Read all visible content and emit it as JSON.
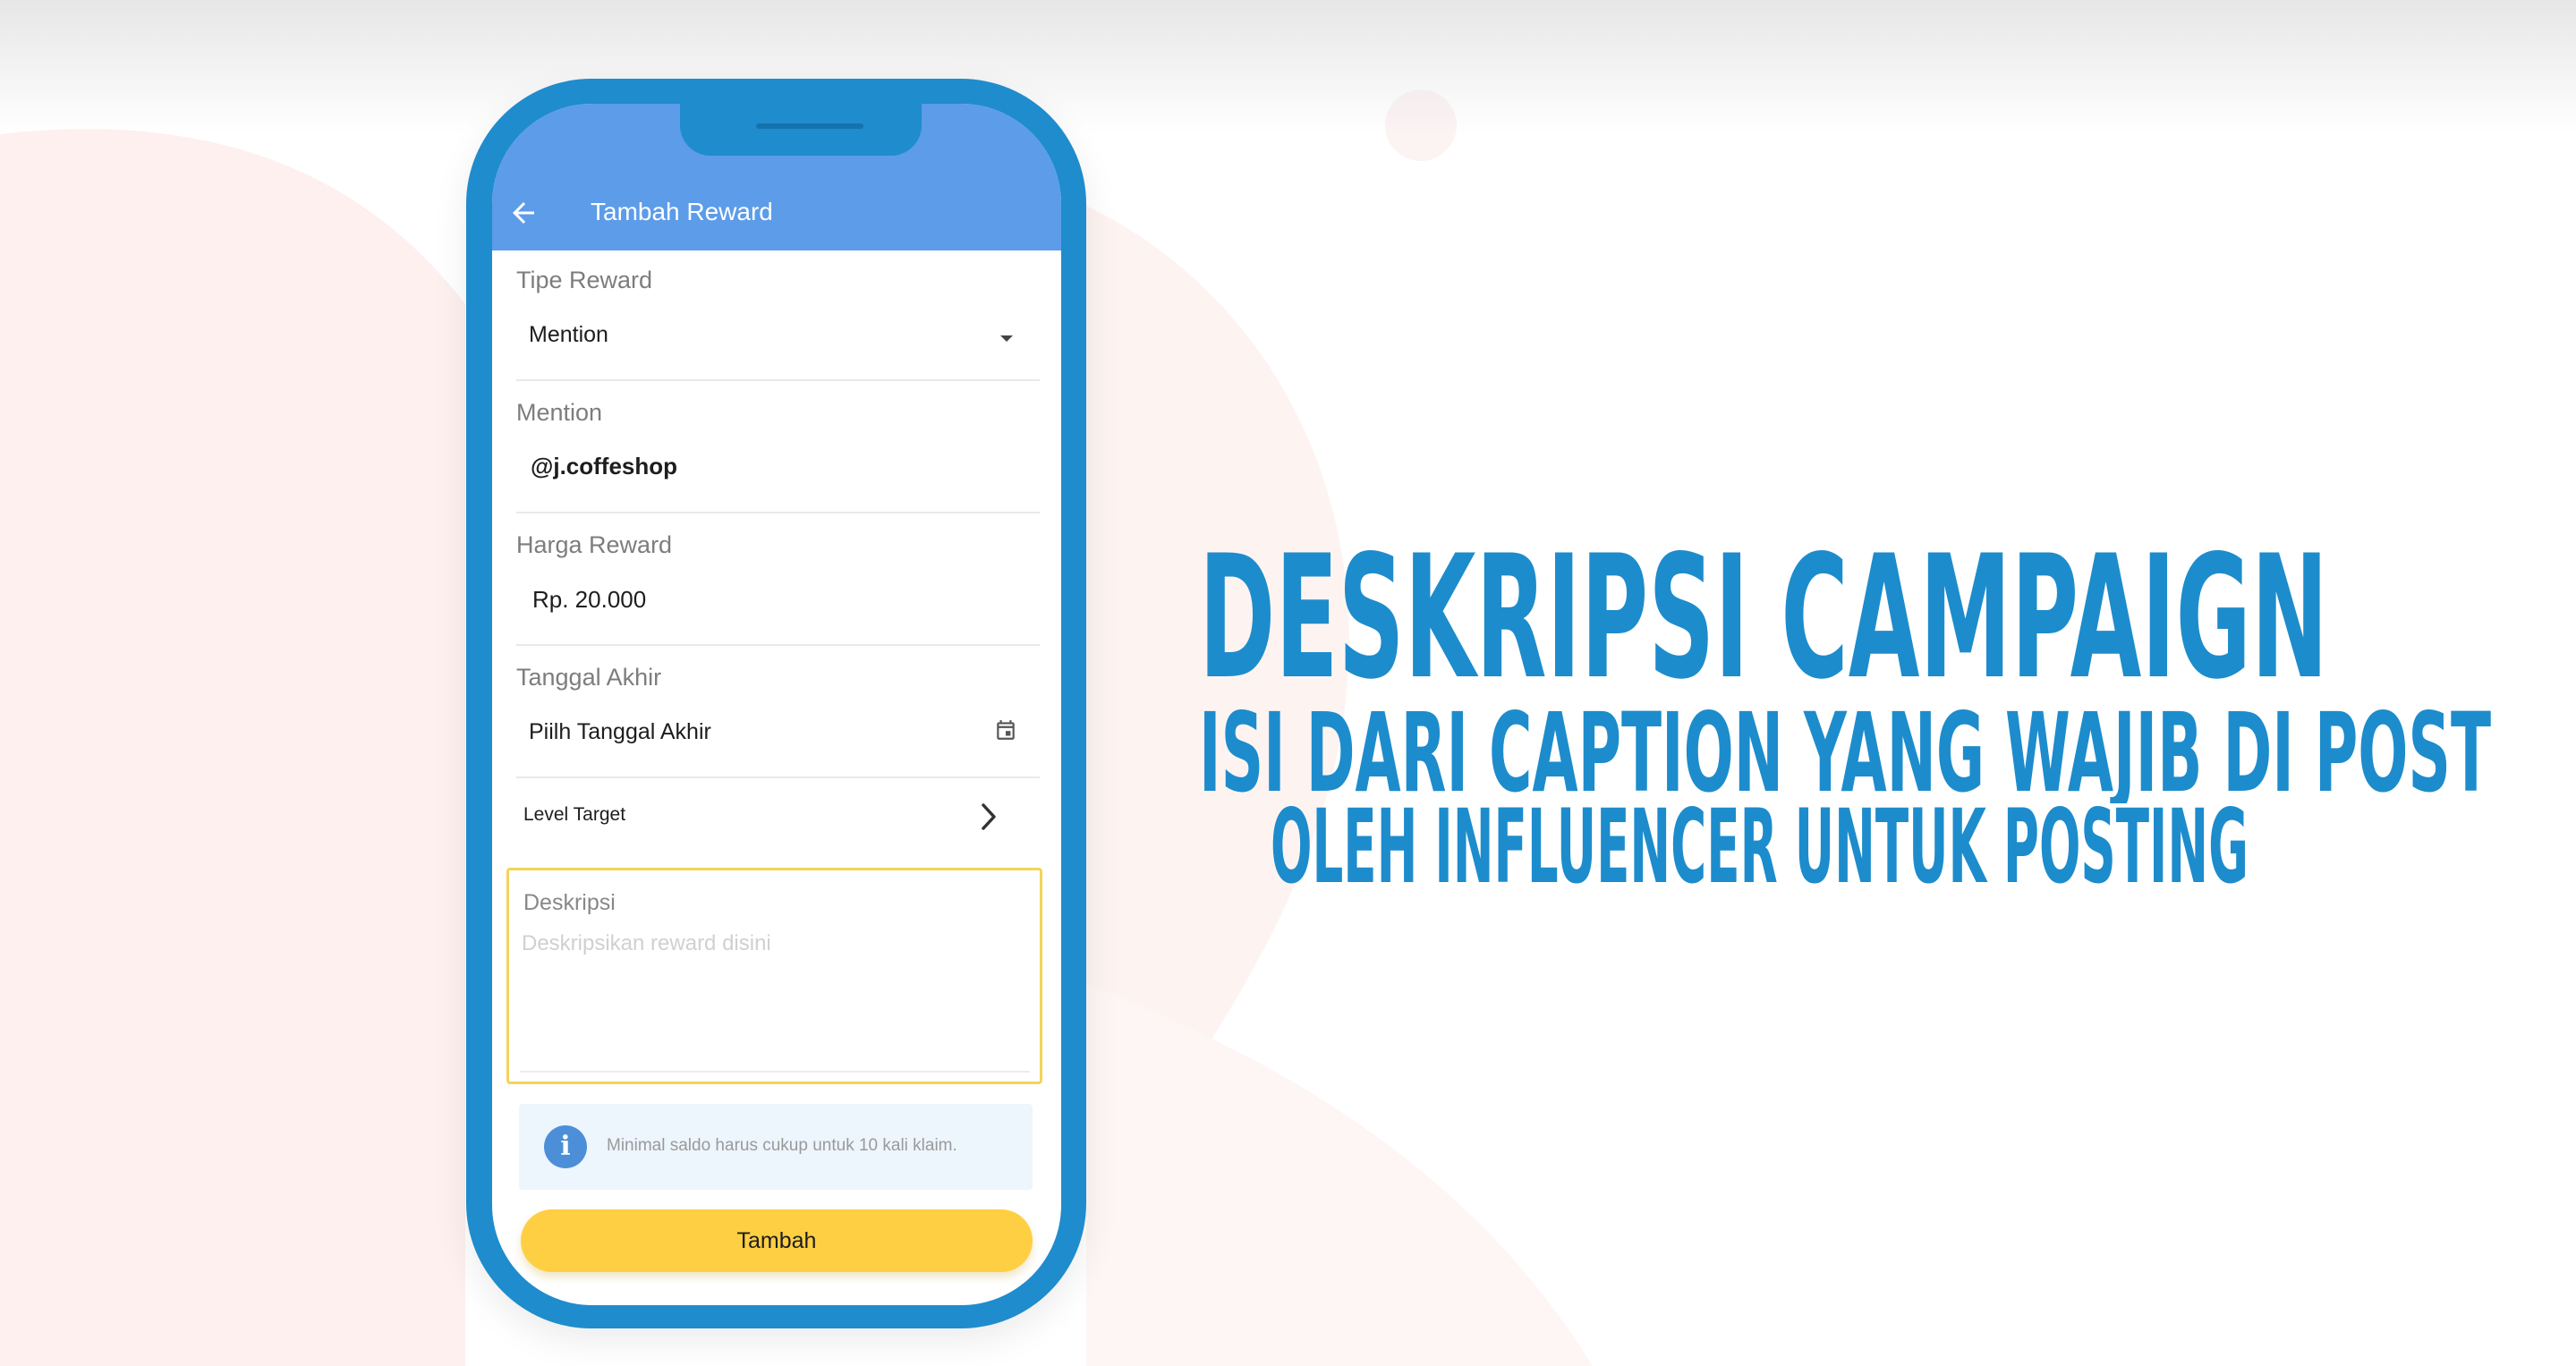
{
  "app": {
    "title": "Tambah Reward",
    "back_icon": "arrow-left-icon"
  },
  "form": {
    "reward_type": {
      "label": "Tipe Reward",
      "value": "Mention",
      "icon": "caret-down-icon"
    },
    "mention": {
      "label": "Mention",
      "value": "@j.coffeshop"
    },
    "price": {
      "label": "Harga Reward",
      "value": "Rp. 20.000"
    },
    "end_date": {
      "label": "Tanggal Akhir",
      "value": "Piilh Tanggal Akhir",
      "icon": "calendar-icon"
    },
    "level_target": {
      "label": "Level Target",
      "icon": "chevron-right-icon"
    },
    "description": {
      "label": "Deskripsi",
      "placeholder": "Deskripsikan reward disini",
      "value": ""
    },
    "info": {
      "text": "Minimal saldo harus cukup untuk 10 kali klaim.",
      "icon": "info-icon"
    },
    "submit_label": "Tambah"
  },
  "caption": {
    "heading": "DESKRIPSI CAMPAIGN",
    "line1": "ISI DARI CAPTION YANG WAJIB DI POST",
    "line2": "OLEH INFLUENCER UNTUK POSTING"
  },
  "colors": {
    "phone_frame": "#1f8ccd",
    "app_bar": "#5c9ce9",
    "button": "#fecf43",
    "focus_border": "#f4d35a",
    "caption_text": "#1d8ccc"
  }
}
